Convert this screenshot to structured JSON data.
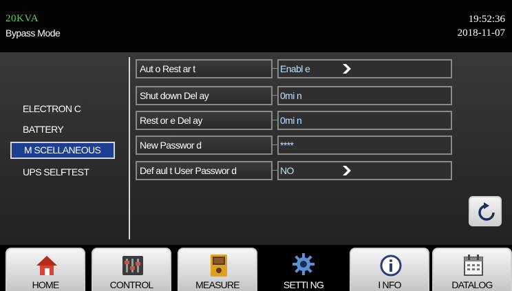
{
  "header": {
    "model": "20KVA",
    "mode": "Bypass Mode",
    "time": "19:52:36",
    "date": "2018-11-07"
  },
  "left_nav": {
    "items": [
      {
        "label": "ELECTRON C",
        "selected": false
      },
      {
        "label": "BATTERY",
        "selected": false
      },
      {
        "label": "M SCELLANEOUS",
        "selected": true
      },
      {
        "label": "UPS SELFTEST",
        "selected": false
      }
    ]
  },
  "settings": {
    "rows": [
      {
        "label": "Aut o  Rest ar t",
        "value": "Enabl e",
        "has_chevron": true
      },
      {
        "label": "Shut down  Del ay",
        "value": "0mi n",
        "has_chevron": false
      },
      {
        "label": "Rest or e  Del ay",
        "value": "0mi n",
        "has_chevron": false
      },
      {
        "label": "New Passwor d",
        "value": "****",
        "has_chevron": false
      },
      {
        "label": "Def aul t User Passwor d",
        "value": "NO",
        "has_chevron": true
      }
    ]
  },
  "bottom_tabs": [
    {
      "label": "HOME",
      "icon": "home-icon",
      "active": false
    },
    {
      "label": "CONTROL",
      "icon": "sliders-icon",
      "active": false
    },
    {
      "label": "MEASURE",
      "icon": "meter-icon",
      "active": false
    },
    {
      "label": "SETTI NG",
      "icon": "gear-icon",
      "active": true
    },
    {
      "label": "I NFO",
      "icon": "info-icon",
      "active": false
    },
    {
      "label": "DATALOG",
      "icon": "calendar-icon",
      "active": false
    }
  ],
  "colors": {
    "model_text": "#5fd15a",
    "selected_nav_bg": "#1d3f92",
    "value_text": "#bfe0ff"
  }
}
